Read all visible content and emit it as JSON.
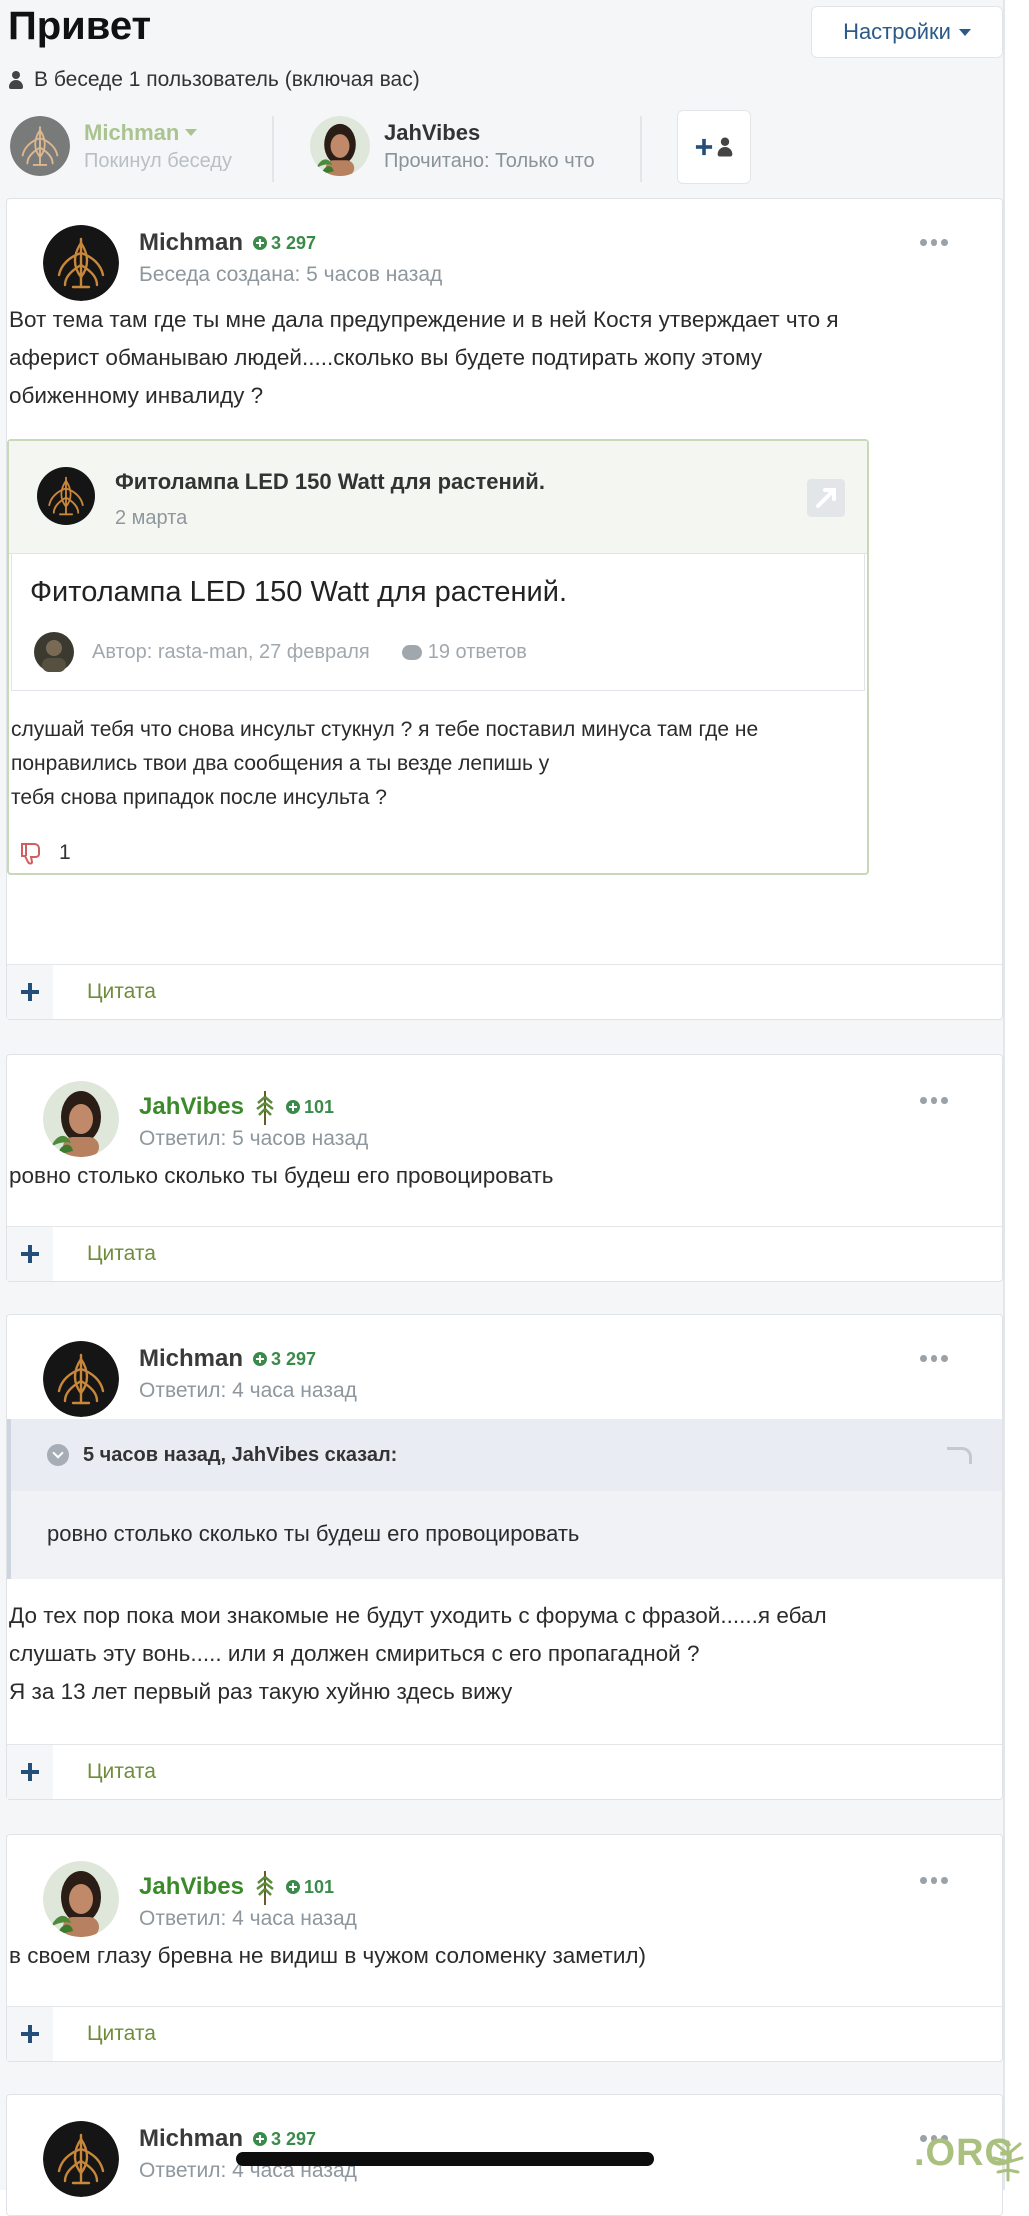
{
  "header": {
    "title": "Привет",
    "settings_label": "Настройки",
    "members_text": "В беседе 1 пользователь (включая вас)"
  },
  "participants": [
    {
      "name": "Michman",
      "status": "Покинул беседу"
    },
    {
      "name": "JahVibes",
      "status": "Прочитано: Только что"
    }
  ],
  "posts": [
    {
      "author": "Michman",
      "reputation": "3 297",
      "meta": "Беседа создана: 5 часов назад",
      "text_lines": [
        "Вот тема там где ты мне дала предупреждение и в ней Костя утверждает что я",
        "аферист обманываю людей.....сколько вы будете подтирать жопу этому",
        "обиженному инвалиду ?"
      ],
      "embed": {
        "title": "Фитолампа LED 150 Watt для растений.",
        "date": "2 марта",
        "topic_title": "Фитолампа LED 150 Watt для растений.",
        "topic_author": "Автор: rasta-man, 27 февраля",
        "topic_replies": "19 ответов",
        "text_lines": [
          "слушай тебя что снова инсульт стукнул ?   я тебе поставил минуса там где не",
          "понравились твои два сообщения а ты везде лепишь у",
          "тебя снова припадок после инсульта ?"
        ],
        "dislike_count": "1"
      },
      "quote_label": "Цитата"
    },
    {
      "author": "JahVibes",
      "reputation": "101",
      "meta": "Ответил: 5 часов назад",
      "text_lines": [
        "ровно столько сколько ты будеш его провоцировать"
      ],
      "quote_label": "Цитата"
    },
    {
      "author": "Michman",
      "reputation": "3 297",
      "meta": "Ответил: 4 часа назад",
      "blockquote": {
        "header": "5 часов назад, JahVibes сказал:",
        "text": "ровно столько сколько ты будеш его провоцировать"
      },
      "text_lines": [
        "До тех пор пока мои знакомые не будут уходить с форума с фразой......я ебал",
        "слушать эту вонь..... или я должен смириться с его пропагадной ?",
        "Я за 13 лет первый раз такую хуйню здесь вижу"
      ],
      "quote_label": "Цитата"
    },
    {
      "author": "JahVibes",
      "reputation": "101",
      "meta": "Ответил: 4 часа назад",
      "text_lines": [
        "в своем глазу бревна не видиш в чужом соломенку заметил)"
      ],
      "quote_label": "Цитата"
    },
    {
      "author": "Michman",
      "reputation": "3 297",
      "meta": "Ответил: 4 часа назад"
    }
  ],
  "watermark": ".ORG",
  "colors": {
    "link_blue": "#2c5a88",
    "green_name": "#3a8a2a",
    "reputation_green": "#3a8a4a",
    "quote_olive": "#6e8c3a",
    "meta_gray": "#8e979d"
  }
}
